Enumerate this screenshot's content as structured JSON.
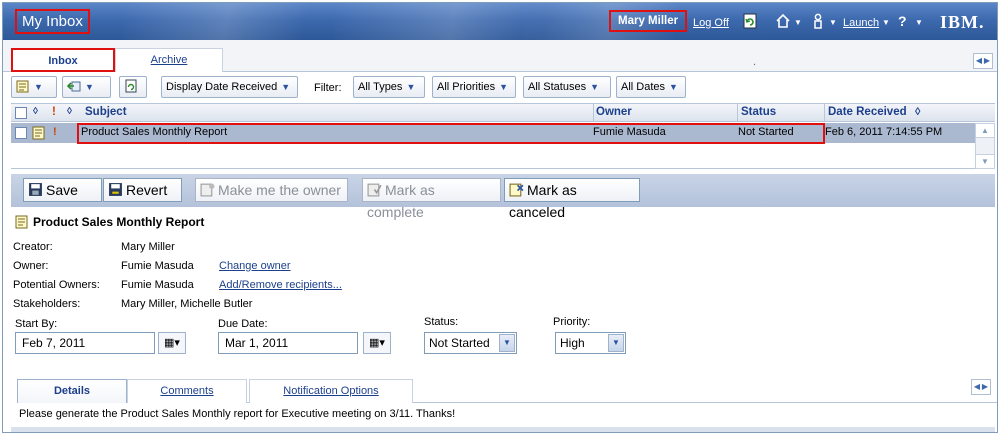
{
  "header": {
    "app_title": "My Inbox",
    "user_name": "Mary Miller",
    "log_off": "Log Off",
    "launch": "Launch",
    "brand": "IBM."
  },
  "tabs": [
    {
      "label": "Inbox",
      "active": true
    },
    {
      "label": "Archive",
      "active": false
    }
  ],
  "tab_dot": ".",
  "toolbar": {
    "sort_select": "Display Date Received",
    "filter_label": "Filter:",
    "filters": [
      "All Types",
      "All Priorities",
      "All Statuses",
      "All Dates"
    ]
  },
  "grid": {
    "columns": [
      "Subject",
      "Owner",
      "Status",
      "Date Received"
    ],
    "rows": [
      {
        "subject": "Product Sales Monthly Report",
        "owner": "Fumie Masuda",
        "status": "Not Started",
        "date_received": "Feb 6, 2011 7:14:55 PM",
        "priority_mark": "!"
      }
    ]
  },
  "detail_actions": {
    "save": "Save",
    "revert": "Revert",
    "make_owner": "Make me the owner",
    "mark_complete": "Mark as complete",
    "mark_canceled": "Mark as canceled"
  },
  "task": {
    "title": "Product Sales Monthly Report",
    "creator_label": "Creator:",
    "creator": "Mary Miller",
    "owner_label": "Owner:",
    "owner": "Fumie Masuda",
    "change_owner": "Change owner",
    "potential_owners_label": "Potential Owners:",
    "potential_owners": "Fumie Masuda",
    "add_remove": "Add/Remove recipients...",
    "stakeholders_label": "Stakeholders:",
    "stakeholders": "Mary Miller, Michelle Butler",
    "start_by_label": "Start By:",
    "start_by": "Feb 7, 2011",
    "due_date_label": "Due Date:",
    "due_date": "Mar 1, 2011",
    "status_label": "Status:",
    "status": "Not Started",
    "priority_label": "Priority:",
    "priority": "High"
  },
  "detail_tabs": [
    "Details",
    "Comments",
    "Notification Options"
  ],
  "description": "Please generate the Product Sales Monthly report for Executive meeting on 3/11. Thanks!",
  "colors": {
    "banner": "#3d69ae",
    "highlight": "#e01010",
    "selected_row": "#aab8d0",
    "link": "#1c3f8c"
  }
}
